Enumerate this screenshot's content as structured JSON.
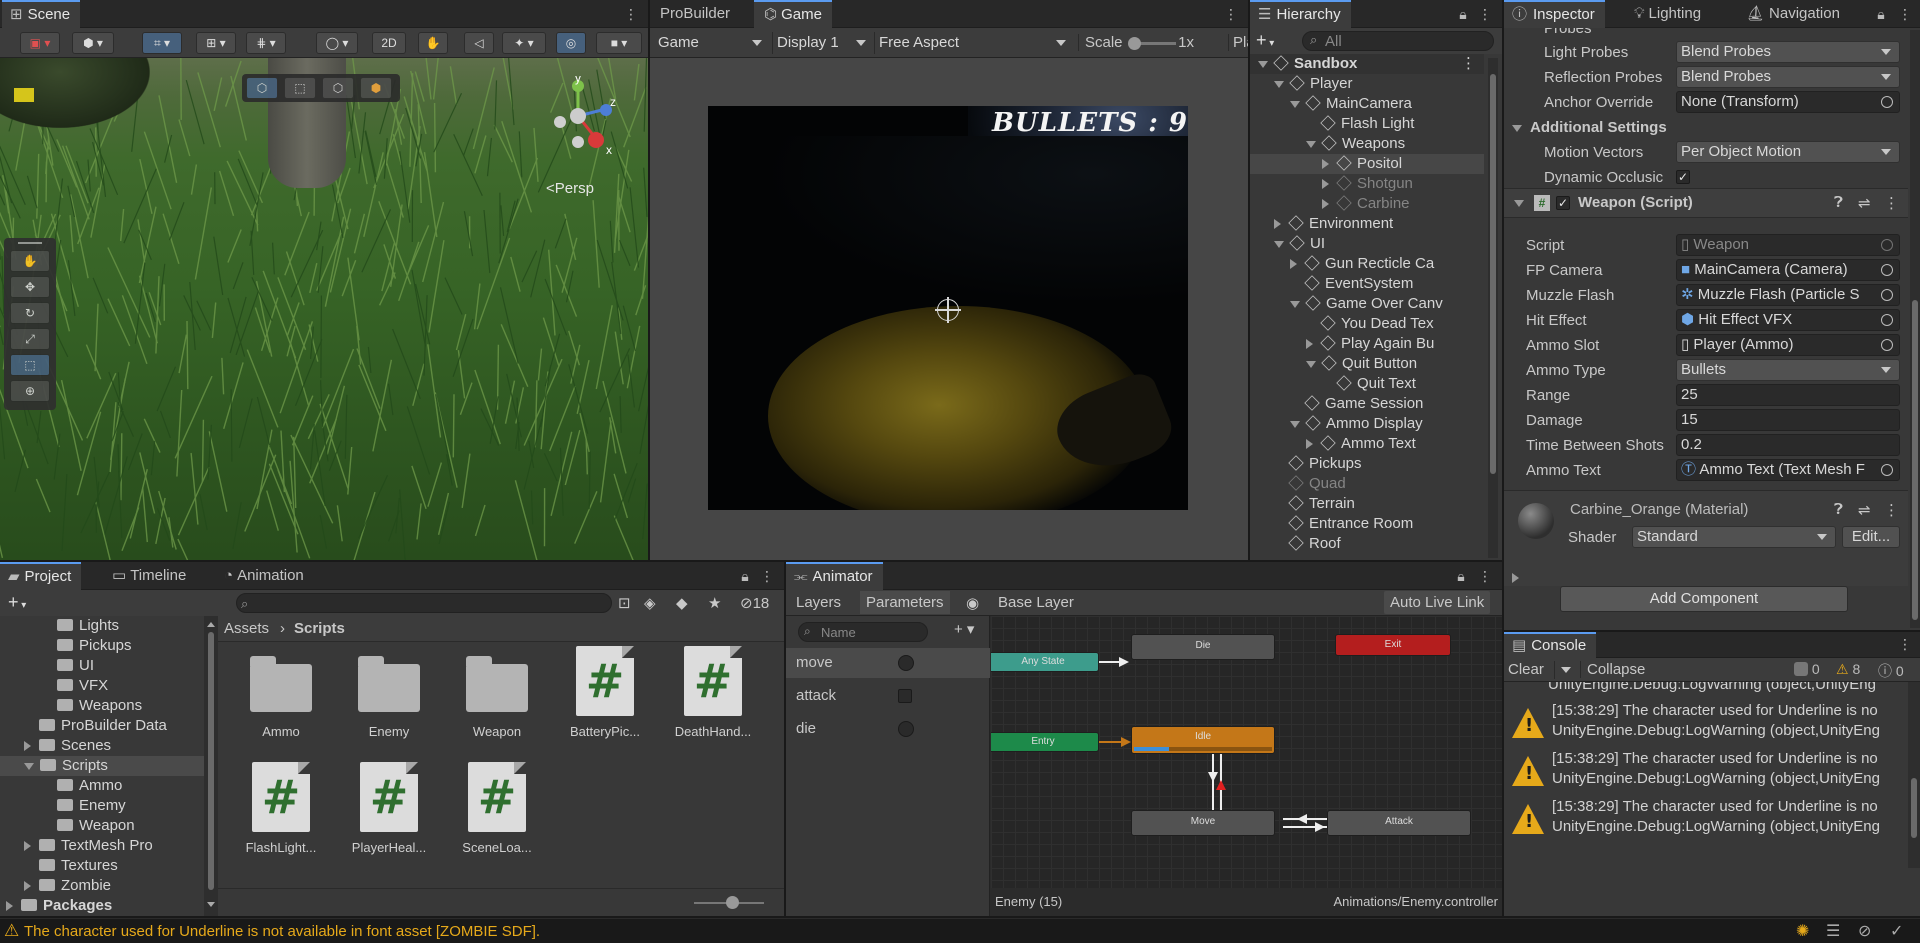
{
  "scene": {
    "tab": "Scene",
    "btn_2d": "2D",
    "persp": "Persp",
    "axis_x": "x",
    "axis_y": "y",
    "axis_z": "z"
  },
  "game": {
    "tab_probuilder": "ProBuilder",
    "tab_game": "Game",
    "mode": "Game",
    "display": "Display 1",
    "aspect": "Free Aspect",
    "scale_label": "Scale",
    "scale_value": "1x",
    "play_label": "Pla",
    "hud_bullets": "BULLETS : 9"
  },
  "hierarchy": {
    "tab": "Hierarchy",
    "search_placeholder": "All",
    "items": [
      {
        "label": "Sandbox",
        "depth": 0,
        "exp": "down",
        "bold": true,
        "scene": true
      },
      {
        "label": "Player",
        "depth": 1,
        "exp": "down"
      },
      {
        "label": "MainCamera",
        "depth": 2,
        "exp": "down"
      },
      {
        "label": "Flash Light",
        "depth": 3,
        "exp": ""
      },
      {
        "label": "Weapons",
        "depth": 3,
        "exp": "down"
      },
      {
        "label": "Positol",
        "depth": 4,
        "exp": "right",
        "selected": true
      },
      {
        "label": "Shotgun",
        "depth": 4,
        "exp": "right",
        "dim": true
      },
      {
        "label": "Carbine",
        "depth": 4,
        "exp": "right",
        "dim": true
      },
      {
        "label": "Environment",
        "depth": 1,
        "exp": "right"
      },
      {
        "label": "UI",
        "depth": 1,
        "exp": "down"
      },
      {
        "label": "Gun Recticle Ca",
        "depth": 2,
        "exp": "right"
      },
      {
        "label": "EventSystem",
        "depth": 2,
        "exp": ""
      },
      {
        "label": "Game Over Canv",
        "depth": 2,
        "exp": "down"
      },
      {
        "label": "You Dead Tex",
        "depth": 3,
        "exp": ""
      },
      {
        "label": "Play Again Bu",
        "depth": 3,
        "exp": "right"
      },
      {
        "label": "Quit Button",
        "depth": 3,
        "exp": "down"
      },
      {
        "label": "Quit Text",
        "depth": 4,
        "exp": ""
      },
      {
        "label": "Game Session",
        "depth": 2,
        "exp": ""
      },
      {
        "label": "Ammo Display",
        "depth": 2,
        "exp": "down"
      },
      {
        "label": "Ammo Text",
        "depth": 3,
        "exp": "right"
      },
      {
        "label": "Pickups",
        "depth": 1,
        "exp": ""
      },
      {
        "label": "Quad",
        "depth": 1,
        "exp": "",
        "dim": true
      },
      {
        "label": "Terrain",
        "depth": 1,
        "exp": ""
      },
      {
        "label": "Entrance Room",
        "depth": 1,
        "exp": ""
      },
      {
        "label": "Roof",
        "depth": 1,
        "exp": ""
      }
    ]
  },
  "inspector": {
    "tab_inspector": "Inspector",
    "tab_lighting": "Lighting",
    "tab_navigation": "Navigation",
    "cut_top": "Probes",
    "light_probes_label": "Light Probes",
    "light_probes": "Blend Probes",
    "reflection_probes_label": "Reflection Probes",
    "reflection_probes": "Blend Probes",
    "anchor_label": "Anchor Override",
    "anchor": "None (Transform)",
    "additional": "Additional Settings",
    "motion_label": "Motion Vectors",
    "motion": "Per Object Motion",
    "dynamic_label": "Dynamic Occlusic",
    "dynamic_check": "✓",
    "component_title": "Weapon (Script)",
    "script_label": "Script",
    "script": "Weapon",
    "fp_label": "FP Camera",
    "fp": "MainCamera (Camera)",
    "muzzle_label": "Muzzle Flash",
    "muzzle": "Muzzle Flash (Particle S",
    "hit_label": "Hit Effect",
    "hit": "Hit Effect VFX",
    "ammoslot_label": "Ammo Slot",
    "ammoslot": "Player (Ammo)",
    "ammotype_label": "Ammo Type",
    "ammotype": "Bullets",
    "range_label": "Range",
    "range": "25",
    "damage_label": "Damage",
    "damage": "15",
    "tbs_label": "Time Between Shots",
    "tbs": "0.2",
    "ammotext_label": "Ammo Text",
    "ammotext": "Ammo Text (Text Mesh F",
    "material": "Carbine_Orange (Material)",
    "shader_label": "Shader",
    "shader": "Standard",
    "edit": "Edit...",
    "add_component": "Add Component"
  },
  "console": {
    "tab": "Console",
    "clear": "Clear",
    "collapse": "Collapse",
    "count_info": "0",
    "count_warn": "8",
    "count_err": "0",
    "cut_line": "UnityEngine.Debug:LogWarning (object,UnityEng",
    "entries": [
      {
        "line1": "[15:38:29] The character used for Underline is no",
        "line2": "UnityEngine.Debug:LogWarning (object,UnityEng"
      },
      {
        "line1": "[15:38:29] The character used for Underline is no",
        "line2": "UnityEngine.Debug:LogWarning (object,UnityEng"
      },
      {
        "line1": "[15:38:29] The character used for Underline is no",
        "line2": "UnityEngine.Debug:LogWarning (object,UnityEng"
      }
    ]
  },
  "project": {
    "tab_project": "Project",
    "tab_timeline": "Timeline",
    "tab_animation": "Animation",
    "hidden_count": "18",
    "breadcrumb_root": "Assets",
    "breadcrumb_current": "Scripts",
    "tree": [
      {
        "label": "Lights",
        "depth": 2,
        "exp": ""
      },
      {
        "label": "Pickups",
        "depth": 2,
        "exp": ""
      },
      {
        "label": "UI",
        "depth": 2,
        "exp": ""
      },
      {
        "label": "VFX",
        "depth": 2,
        "exp": ""
      },
      {
        "label": "Weapons",
        "depth": 2,
        "exp": ""
      },
      {
        "label": "ProBuilder Data",
        "depth": 1,
        "exp": ""
      },
      {
        "label": "Scenes",
        "depth": 1,
        "exp": "right"
      },
      {
        "label": "Scripts",
        "depth": 1,
        "exp": "down",
        "selected": true
      },
      {
        "label": "Ammo",
        "depth": 2,
        "exp": ""
      },
      {
        "label": "Enemy",
        "depth": 2,
        "exp": ""
      },
      {
        "label": "Weapon",
        "depth": 2,
        "exp": ""
      },
      {
        "label": "TextMesh Pro",
        "depth": 1,
        "exp": "right"
      },
      {
        "label": "Textures",
        "depth": 1,
        "exp": ""
      },
      {
        "label": "Zombie",
        "depth": 1,
        "exp": "right"
      },
      {
        "label": "Packages",
        "depth": 0,
        "exp": "right",
        "bold": true
      }
    ],
    "assets": [
      {
        "label": "Ammo",
        "kind": "folder"
      },
      {
        "label": "Enemy",
        "kind": "folder"
      },
      {
        "label": "Weapon",
        "kind": "folder"
      },
      {
        "label": "BatteryPic...",
        "kind": "script"
      },
      {
        "label": "DeathHand...",
        "kind": "script"
      },
      {
        "label": "FlashLight...",
        "kind": "script"
      },
      {
        "label": "PlayerHeal...",
        "kind": "script"
      },
      {
        "label": "SceneLoa...",
        "kind": "script"
      }
    ],
    "script_glyph": "#"
  },
  "animator": {
    "tab": "Animator",
    "tab_layers": "Layers",
    "tab_parameters": "Parameters",
    "layer": "Base Layer",
    "autolive": "Auto Live Link",
    "search_placeholder": "Name",
    "params": [
      {
        "name": "move",
        "type": "trigger"
      },
      {
        "name": "attack",
        "type": "bool"
      },
      {
        "name": "die",
        "type": "trigger"
      }
    ],
    "nodes": {
      "any": "Any State",
      "die": "Die",
      "exit": "Exit",
      "entry": "Entry",
      "idle": "Idle",
      "move": "Move",
      "attack": "Attack"
    },
    "idle_progress": 0.25,
    "footer_left": "Enemy (15)",
    "footer_right": "Animations/Enemy.controller"
  },
  "status": {
    "message": "The character used for Underline is not available in font asset [ZOMBIE SDF]."
  },
  "colors": {
    "accent": "#5b9bf0",
    "idle_node": "#c47718",
    "entry_node": "#1d8a4a",
    "anystate_node": "#3d9c8c",
    "exit_node": "#b41e1e",
    "warning": "#e6a91a"
  }
}
